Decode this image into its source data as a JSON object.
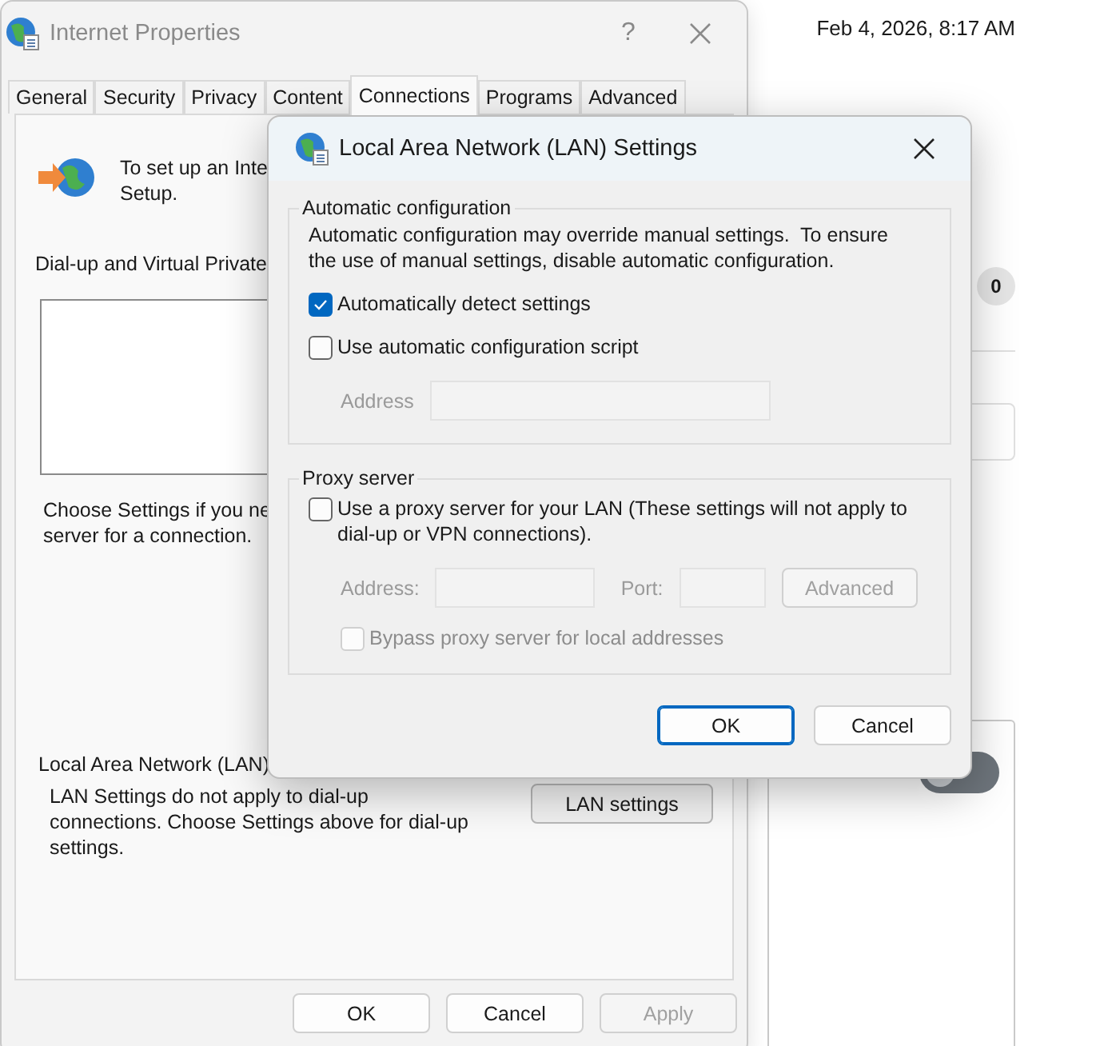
{
  "background": {
    "timestamp": "Feb 4, 2026, 8:17 AM",
    "badge": "0",
    "toggle": {
      "on": false
    }
  },
  "main_window": {
    "title": "Internet Properties",
    "help": "?",
    "tabs": [
      {
        "label": "General",
        "selected": false
      },
      {
        "label": "Security",
        "selected": false
      },
      {
        "label": "Privacy",
        "selected": false
      },
      {
        "label": "Content",
        "selected": false
      },
      {
        "label": "Connections",
        "selected": true
      },
      {
        "label": "Programs",
        "selected": false
      },
      {
        "label": "Advanced",
        "selected": false
      }
    ],
    "setup_text": "To set up an Inte\nSetup.",
    "vpn_label": "Dial-up and Virtual Private",
    "proxy_hint": "Choose Settings if you ne\nserver for a connection.",
    "lan_label": "Local Area Network (LAN)",
    "lan_text": "LAN Settings do not apply to dial-up\nconnections. Choose Settings above for dial-up\nsettings.",
    "lan_button": "LAN settings",
    "buttons": [
      {
        "label": "OK",
        "disabled": false
      },
      {
        "label": "Cancel",
        "disabled": false
      },
      {
        "label": "Apply",
        "disabled": true
      }
    ]
  },
  "dialog": {
    "title": "Local Area Network (LAN) Settings",
    "groups": [
      {
        "title": "Automatic configuration",
        "description": "Automatic configuration may override manual settings.  To ensure\nthe use of manual settings, disable automatic configuration.",
        "options": [
          {
            "kind": "checkbox",
            "label": "Automatically detect settings",
            "checked": true,
            "disabled": false
          },
          {
            "kind": "checkbox",
            "label": "Use automatic configuration script",
            "checked": false,
            "disabled": false
          },
          {
            "kind": "address",
            "label": "Address",
            "disabled": true
          }
        ]
      },
      {
        "title": "Proxy server",
        "options": [
          {
            "kind": "checkbox",
            "label": "Use a proxy server for your LAN (These settings will not apply to\ndial-up or VPN connections).",
            "checked": false,
            "disabled": false
          },
          {
            "kind": "proxy",
            "address_label": "Address:",
            "port_label": "Port:",
            "button": "Advanced",
            "disabled": true
          },
          {
            "kind": "subcheckbox",
            "label": "Bypass proxy server for local addresses",
            "checked": false,
            "disabled": true
          }
        ]
      }
    ],
    "buttons": [
      {
        "label": "OK",
        "default": true
      },
      {
        "label": "Cancel",
        "default": false
      }
    ]
  }
}
